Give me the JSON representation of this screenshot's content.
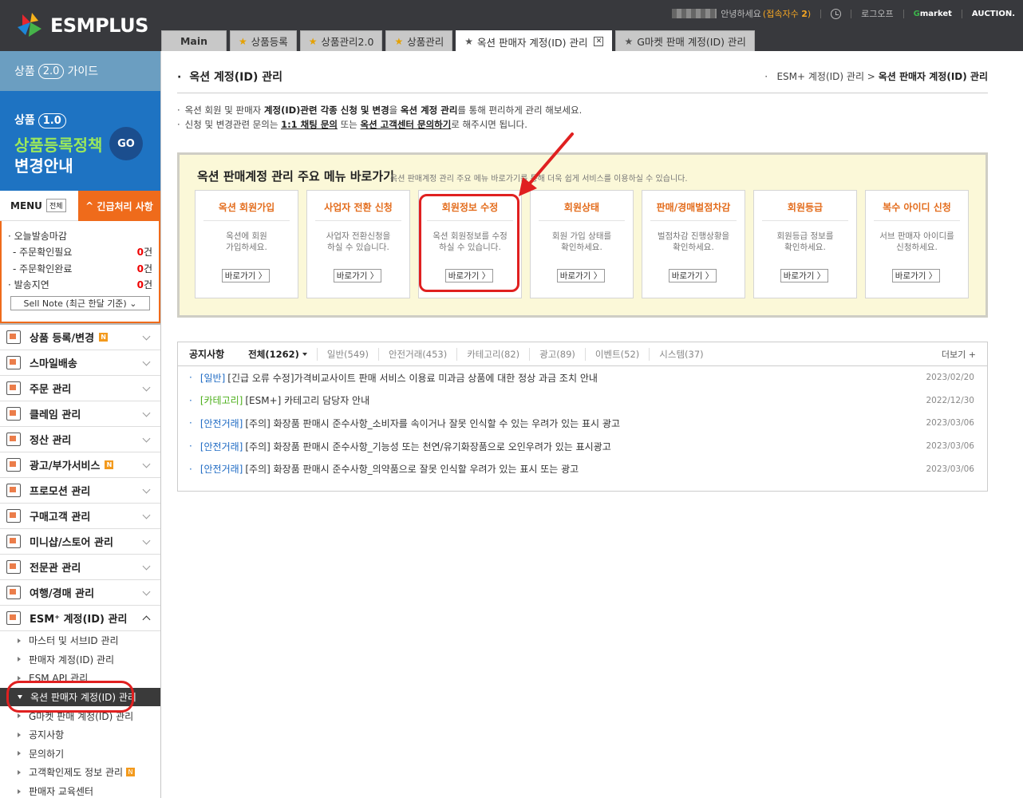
{
  "header": {
    "logo": "ESMPLUS",
    "greeting": "안녕하세요",
    "connections_label": "접속자수",
    "connections_count": "2",
    "logout": "로그오프",
    "gmarket": "Gmarket",
    "auction": "AUCTION."
  },
  "tabs": [
    {
      "label": "Main"
    },
    {
      "label": "상품등록"
    },
    {
      "label": "상품관리2.0"
    },
    {
      "label": "상품관리"
    },
    {
      "label": "옥션 판매자 계정(ID) 관리"
    },
    {
      "label": "G마켓 판매 계정(ID) 관리"
    }
  ],
  "sidebar": {
    "guide": {
      "prefix": "상품",
      "version": "2.0",
      "suffix": "가이드"
    },
    "banner": {
      "prefix": "상품",
      "version": "1.0",
      "line2": "상품등록정책",
      "line3": "변경안내",
      "go": "GO"
    },
    "menu_label": "MENU",
    "menu_all": "전체",
    "urgent": "긴급처리 사항",
    "orders": [
      {
        "label": "· 오늘발송마감",
        "count": ""
      },
      {
        "label": "- 주문확인필요",
        "count": "0"
      },
      {
        "label": "- 주문확인완료",
        "count": "0"
      },
      {
        "label": "· 발송지연",
        "count": "0"
      }
    ],
    "count_unit": "건",
    "sell_note": "Sell Note (최근 한달 기준)",
    "nav": [
      {
        "label": "상품 등록/변경",
        "new": true
      },
      {
        "label": "스마일배송",
        "new": false
      },
      {
        "label": "주문 관리",
        "new": false
      },
      {
        "label": "클레임 관리",
        "new": false
      },
      {
        "label": "정산 관리",
        "new": false
      },
      {
        "label": "광고/부가서비스",
        "new": true
      },
      {
        "label": "프로모션 관리",
        "new": false
      },
      {
        "label": "구매고객 관리",
        "new": false
      },
      {
        "label": "미니샵/스토어 관리",
        "new": false
      },
      {
        "label": "전문관 관리",
        "new": false
      },
      {
        "label": "여행/경매 관리",
        "new": false
      },
      {
        "label": "ESM⁺ 계정(ID) 관리",
        "new": false
      }
    ],
    "new_badge": "N",
    "submenu": [
      {
        "label": "마스터 및 서브ID 관리"
      },
      {
        "label": "판매자 계정(ID) 관리"
      },
      {
        "label": "ESM API 관리"
      },
      {
        "label": "옥션 판매자 계정(ID) 관리"
      },
      {
        "label": "G마켓 판매 계정(ID) 관리"
      },
      {
        "label": "공지사항"
      },
      {
        "label": "문의하기"
      },
      {
        "label": "고객확인제도 정보 관리"
      },
      {
        "label": "판매자 교육센터"
      }
    ]
  },
  "main": {
    "title": "옥션 계정(ID) 관리",
    "breadcrumb_parent": "ESM+ 계정(ID) 관리 >",
    "breadcrumb_current": "옥션 판매자 계정(ID) 관리",
    "intro1_a": "옥션 회원 및 판매자 ",
    "intro1_b": "계정(ID)관련 각종 신청 및 변경",
    "intro1_c": "을 ",
    "intro1_d": "옥션 계정 관리",
    "intro1_e": "를 통해 편리하게 관리 해보세요.",
    "intro2_a": "신청 및 변경관련 문의는 ",
    "intro2_b": "1:1 채팅 문의",
    "intro2_c": " 또는 ",
    "intro2_d": "옥션 고객센터 문의하기",
    "intro2_e": "로 해주시면 됩니다.",
    "shortcut_title": "옥션 판매계정 관리 주요 메뉴 바로가기",
    "shortcut_desc": "옥션 판매계정 관리 주요 메뉴 바로가기를 통해 더욱 쉽게 서비스를 이용하실 수 있습니다.",
    "go_label": "바로가기 〉",
    "cards": [
      {
        "title": "옥션 회원가입",
        "desc": "옥션에 회원\n가입하세요."
      },
      {
        "title": "사업자 전환 신청",
        "desc": "사업자 전환신청을\n하실 수 있습니다."
      },
      {
        "title": "회원정보 수정",
        "desc": "옥션 회원정보를 수정\n하실 수 있습니다."
      },
      {
        "title": "회원상태",
        "desc": "회원 가입 상태를\n확인하세요."
      },
      {
        "title": "판매/경매벌점차감",
        "desc": "벌점차감 진행상황을\n확인하세요."
      },
      {
        "title": "회원등급",
        "desc": "회원등급 정보를\n확인하세요."
      },
      {
        "title": "복수 아이디 신청",
        "desc": "서브 판매자 아이디를\n신청하세요."
      }
    ],
    "notice": {
      "title": "공지사항",
      "categories": [
        "전체(1262)",
        "일반(549)",
        "안전거래(453)",
        "카테고리(82)",
        "광고(89)",
        "이벤트(52)",
        "시스템(37)"
      ],
      "more": "더보기 +",
      "items": [
        {
          "tag": "[일반]",
          "tag_color": "#1f6bc4",
          "text": "[긴급 오류 수정]가격비교사이트 판매 서비스 이용료 미과금 상품에 대한 정상 과금 조치 안내",
          "date": "2023/02/20"
        },
        {
          "tag": "[카테고리]",
          "tag_color": "#4caf1a",
          "text": "[ESM+] 카테고리 담당자 안내",
          "date": "2022/12/30"
        },
        {
          "tag": "[안전거래]",
          "tag_color": "#1f6bc4",
          "text": "[주의] 화장품 판매시 준수사항_소비자를 속이거나 잘못 인식할 수 있는 우려가 있는 표시 광고",
          "date": "2023/03/06"
        },
        {
          "tag": "[안전거래]",
          "tag_color": "#1f6bc4",
          "text": "[주의] 화장품 판매시 준수사항_기능성 또는 천연/유기화장품으로 오인우려가 있는 표시광고",
          "date": "2023/03/06"
        },
        {
          "tag": "[안전거래]",
          "tag_color": "#1f6bc4",
          "text": "[주의] 화장품 판매시 준수사항_의약품으로 잘못 인식할 우려가 있는 표시 또는 광고",
          "date": "2023/03/06"
        }
      ]
    }
  }
}
